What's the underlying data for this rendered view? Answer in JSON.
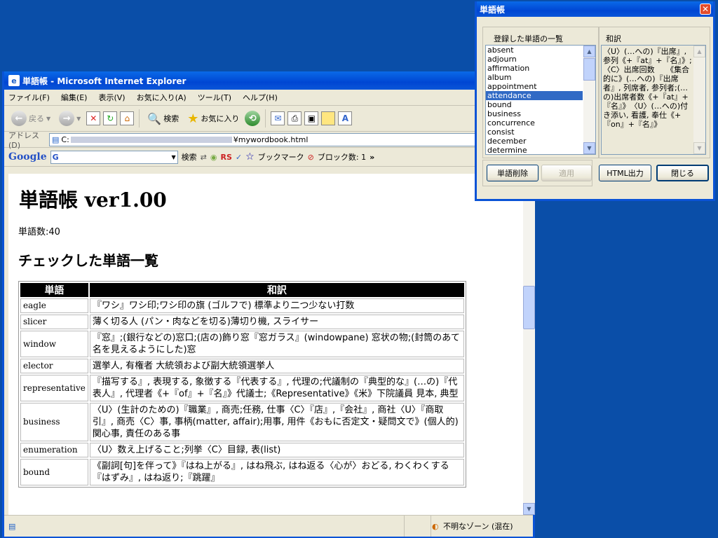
{
  "ie": {
    "title": "単語帳 - Microsoft Internet Explorer",
    "menu": [
      "ファイル(F)",
      "編集(E)",
      "表示(V)",
      "お気に入り(A)",
      "ツール(T)",
      "ヘルプ(H)"
    ],
    "back_label": "戻る",
    "search_label": "検索",
    "favorites_label": "お気に入り",
    "address_label": "アドレス(D)",
    "address_prefix": "C:",
    "address_suffix": "¥mywordbook.html",
    "google_logo": "Google",
    "google_search_button": "検索",
    "rs_label": "RS",
    "bookmark_label": "ブックマーク",
    "popup_block_label": "ブロック数: 1",
    "status_zone": "不明なゾーン (混在)"
  },
  "page": {
    "title": "単語帳 ver1.00",
    "word_count": "単語数:40",
    "checked_heading": "チェックした単語一覧",
    "table_headers": [
      "単語",
      "和訳"
    ],
    "rows": [
      {
        "word": "eagle",
        "meaning": "『ワシ』ワシ印;ワシ印の旗 (ゴルフで) 標準より二つ少ない打数"
      },
      {
        "word": "slicer",
        "meaning": "薄く切る人 (パン・肉などを切る)薄切り機, スライサー"
      },
      {
        "word": "window",
        "meaning": "『窓』;(銀行などの)窓口;(店の)飾り窓『窓ガラス』(windowpane) 窓状の物;(封筒のあて名を見えるようにした)窓"
      },
      {
        "word": "elector",
        "meaning": "選挙人, 有権者 大統領および副大統領選挙人"
      },
      {
        "word": "representative",
        "meaning": "『描写する』, 表現する, 象徴する『代表する』, 代理の;代議制の『典型的な』(…の)『代表人』, 代理者《+『of』+『名』》代議士;《Representative》《米》下院議員 見本, 典型"
      },
      {
        "word": "business",
        "meaning": "〈U〉(生計のための)『職業』, 商売;任務, 仕事〈C〉『店』,『会社』, 商社〈U〉『商取引』, 商売〈C〉事, 事柄(matter, affair);用事, 用件《おもに否定文・疑問文で》(個人的)関心事, 責任のある事"
      },
      {
        "word": "enumeration",
        "meaning": "〈U〉数え上げること;列挙〈C〉目録, 表(list)"
      },
      {
        "word": "bound",
        "meaning": "《副詞[句]を伴って》『はね上がる』, はね飛ぶ, はね返る〈心が〉おどる, わくわくする『はずみ』, はね返り;『跳躍』"
      }
    ]
  },
  "dialog": {
    "title": "単語帳",
    "list_label": "登録した単語の一覧",
    "translation_label": "和訳",
    "words": [
      "absent",
      "adjourn",
      "affirmation",
      "album",
      "appointment",
      "attendance",
      "bound",
      "business",
      "concurrence",
      "consist",
      "december",
      "determine"
    ],
    "selected_word": "attendance",
    "translation_text": "〈U〉(…への)『出席』, 参列《+『at』+『名』》;〈C〉出席回数　　《集合的に》(…への)『出席者』, 列席者, 参列者;(…の)出席者数《+『at』+『名』》　〈U〉(…への)付き添い, 看護, 奉仕《+『on』+『名』》",
    "delete_button": "単語削除",
    "apply_button": "適用",
    "html_button": "HTML出力",
    "close_button": "閉じる"
  },
  "colors": {
    "desktop": "#0a4ea8",
    "titlebar": "#0058e6",
    "selection": "#316ac5"
  }
}
